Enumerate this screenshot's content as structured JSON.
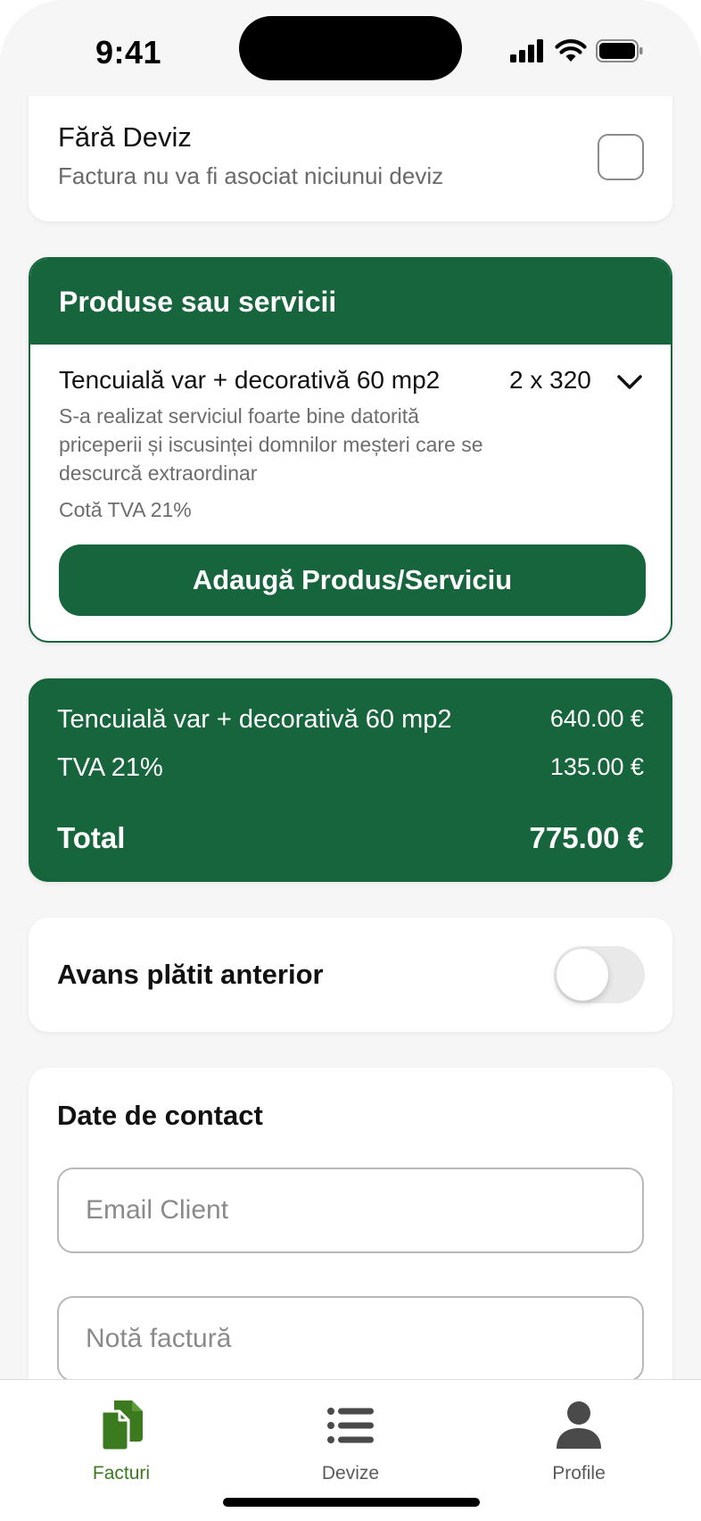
{
  "status_bar": {
    "time": "9:41"
  },
  "no_estimate": {
    "title": "Fără Deviz",
    "subtitle": "Factura nu va fi asociat niciunui deviz",
    "checked": false
  },
  "products": {
    "header": "Produse sau servicii",
    "item": {
      "name": "Tencuială var + decorativă 60 mp2",
      "quantity": "2 x 320",
      "description": "S-a realizat serviciul foarte bine datorită priceperii și iscusinței domnilor meșteri care se descurcă extraordinar",
      "vat": "Cotă TVA 21%"
    },
    "add_button": "Adaugă Produs/Serviciu"
  },
  "summary": {
    "line_label": "Tencuială var + decorativă 60 mp2",
    "line_value": "640.00 €",
    "vat_label": "TVA 21%",
    "vat_value": "135.00 €",
    "total_label": "Total",
    "total_value": "775.00 €"
  },
  "advance": {
    "label": "Avans plătit anterior",
    "enabled": false
  },
  "contact": {
    "title": "Date de contact",
    "email_placeholder": "Email Client",
    "note_placeholder": "Notă factură"
  },
  "tabs": [
    {
      "label": "Facturi",
      "icon": "documents-icon",
      "active": true
    },
    {
      "label": "Devize",
      "icon": "list-icon",
      "active": false
    },
    {
      "label": "Profile",
      "icon": "person-icon",
      "active": false
    }
  ],
  "colors": {
    "primary_green": "#17653d",
    "active_tab": "#3c7a1f",
    "background": "#f6f6f6"
  }
}
